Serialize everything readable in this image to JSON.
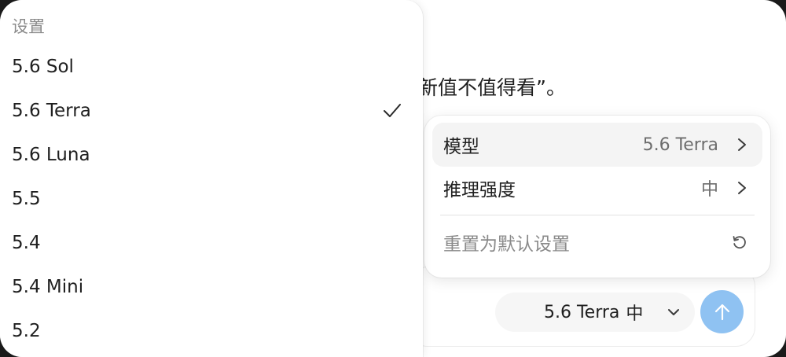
{
  "background_message": {
    "text": "新值不值得看”。"
  },
  "model_list": {
    "header": "设置",
    "items": [
      {
        "label": "5.6 Sol",
        "selected": false
      },
      {
        "label": "5.6 Terra",
        "selected": true
      },
      {
        "label": "5.6 Luna",
        "selected": false
      },
      {
        "label": "5.5",
        "selected": false
      },
      {
        "label": "5.4",
        "selected": false
      },
      {
        "label": "5.4 Mini",
        "selected": false
      },
      {
        "label": "5.2",
        "selected": false
      }
    ]
  },
  "settings_menu": {
    "model_label": "模型",
    "model_value": "5.6 Terra",
    "effort_label": "推理强度",
    "effort_value": "中",
    "reset_label": "重置为默认设置"
  },
  "composer": {
    "model_pill_label": "5.6 Terra",
    "model_pill_effort": "中"
  },
  "colors": {
    "send_button": "#8fc2f2",
    "active_row": "#f4f4f4",
    "muted_text": "#8a8a8a"
  },
  "icons": {
    "check": "check-icon",
    "chevron_right": "chevron-right-icon",
    "chevron_down": "chevron-down-icon",
    "reset": "reset-icon",
    "send": "arrow-up-icon"
  }
}
